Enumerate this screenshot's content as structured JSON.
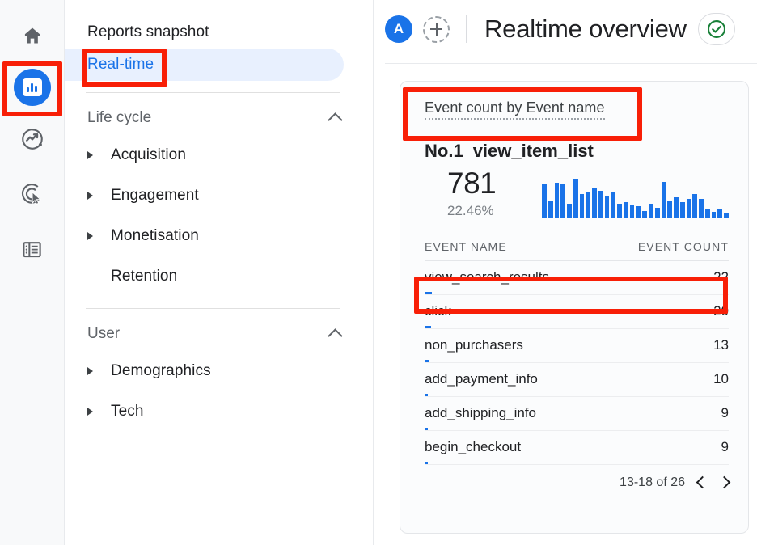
{
  "rail": {
    "items": [
      {
        "name": "home-icon",
        "label": "Home"
      },
      {
        "name": "reports-icon",
        "label": "Reports"
      },
      {
        "name": "explore-icon",
        "label": "Explore"
      },
      {
        "name": "advertising-icon",
        "label": "Advertising"
      },
      {
        "name": "configure-icon",
        "label": "Configure"
      }
    ]
  },
  "nav": {
    "snapshot_label": "Reports snapshot",
    "realtime_label": "Real-time",
    "groups": [
      {
        "label": "Life cycle",
        "items": [
          {
            "label": "Acquisition",
            "expandable": true
          },
          {
            "label": "Engagement",
            "expandable": true
          },
          {
            "label": "Monetisation",
            "expandable": true
          },
          {
            "label": "Retention",
            "expandable": false
          }
        ]
      },
      {
        "label": "User",
        "items": [
          {
            "label": "Demographics",
            "expandable": true
          },
          {
            "label": "Tech",
            "expandable": true
          }
        ]
      }
    ]
  },
  "header": {
    "avatar_letter": "A",
    "add_label": "+",
    "title": "Realtime overview"
  },
  "card": {
    "title": "Event count by Event name",
    "rank_label": "No.1",
    "rank_value": "view_item_list",
    "big_number": "781",
    "percent": "22.46%",
    "columns": {
      "name": "EVENT NAME",
      "count": "EVENT COUNT"
    },
    "rows": [
      {
        "name": "view_search_results",
        "count": "22",
        "bar_pct": 2.4
      },
      {
        "name": "click",
        "count": "20",
        "bar_pct": 2.1
      },
      {
        "name": "non_purchasers",
        "count": "13",
        "bar_pct": 1.4
      },
      {
        "name": "add_payment_info",
        "count": "10",
        "bar_pct": 1.1
      },
      {
        "name": "add_shipping_info",
        "count": "9",
        "bar_pct": 1.0
      },
      {
        "name": "begin_checkout",
        "count": "9",
        "bar_pct": 1.0
      }
    ],
    "pagination": {
      "range": "13-18 of 26",
      "prev": "‹",
      "next": "›"
    }
  },
  "chart_data": {
    "type": "bar",
    "title": "Event count by Event name sparkline",
    "xlabel": "",
    "ylabel": "Event count",
    "categories": [
      "1",
      "2",
      "3",
      "4",
      "5",
      "6",
      "7",
      "8",
      "9",
      "10",
      "11",
      "12",
      "13",
      "14",
      "15",
      "16",
      "17",
      "18",
      "19",
      "20",
      "21",
      "22",
      "23",
      "24",
      "25",
      "26",
      "27",
      "28",
      "29",
      "30"
    ],
    "values": [
      42,
      22,
      45,
      44,
      18,
      50,
      30,
      32,
      38,
      34,
      28,
      32,
      18,
      20,
      16,
      14,
      8,
      18,
      12,
      46,
      22,
      26,
      20,
      24,
      30,
      24,
      10,
      7,
      11,
      5
    ],
    "ylim": [
      0,
      52
    ],
    "grid": false,
    "legend": "none",
    "color": "#1a73e8"
  },
  "colors": {
    "accent_blue": "#1a73e8",
    "active_bg": "#e8f0fe",
    "annotation_red": "#f81f07",
    "check_green": "#188038",
    "text_primary": "#202124",
    "text_secondary": "#5f6368"
  }
}
